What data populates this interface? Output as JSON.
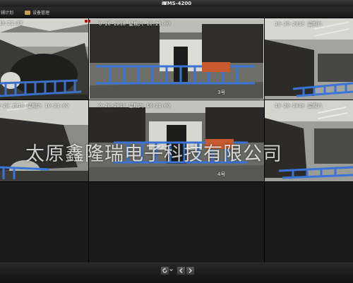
{
  "window": {
    "title": "iVMS-4200"
  },
  "menu": [
    {
      "label": "辅计划"
    },
    {
      "label": "设备管理"
    }
  ],
  "cameras": [
    {
      "timestamp": "1-20-2018",
      "label": "",
      "time2": "10:21:00"
    },
    {
      "timestamp": "0-20-2018 星期六 10:21:00",
      "label": "3号"
    },
    {
      "timestamp": "10-20-2018 星期六",
      "label": ""
    },
    {
      "timestamp": "0-20-2018 星期六 10:21:00",
      "label": ""
    },
    {
      "timestamp": "0-20-2018 星期六 10:21:00",
      "label": "4号"
    },
    {
      "timestamp": "10-20-2018 星期六",
      "label": ""
    }
  ],
  "watermark": "太原鑫隆瑞电子科技有限公司",
  "controls": {
    "cycle_icon": "cycle-icon",
    "prev_icon": "arrow-left-icon",
    "next_icon": "arrow-right-icon"
  }
}
